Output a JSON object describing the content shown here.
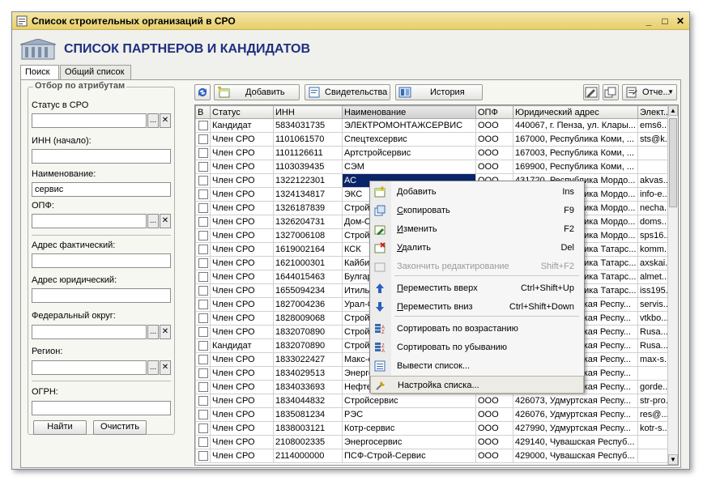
{
  "window": {
    "title": "Список строительных организаций в СРО",
    "minimize": "_",
    "restore": "□",
    "close": "✕"
  },
  "page_title": "СПИСОК ПАРТНЕРОВ И КАНДИДАТОВ",
  "tabs": [
    "Поиск",
    "Общий список"
  ],
  "filter": {
    "legend": "Отбор по атрибутам",
    "status_label": "Статус в СРО",
    "status_value": "",
    "inn_label": "ИНН (начало):",
    "inn_value": "",
    "name_label": "Наименование:",
    "name_value": "сервис",
    "opf_label": "ОПФ:",
    "opf_value": "",
    "addr_fact_label": "Адрес фактический:",
    "addr_fact_value": "",
    "addr_jur_label": "Адрес юридический:",
    "addr_jur_value": "",
    "fed_okrug_label": "Федеральный округ:",
    "fed_okrug_value": "",
    "region_label": "Регион:",
    "region_value": "",
    "ogrn_label": "ОГРН:",
    "ogrn_value": "",
    "select_btn": "...",
    "clear_btn": "✕",
    "find_btn": "Найти",
    "reset_btn": "Очистить"
  },
  "toolbar": {
    "add": "Добавить",
    "certs": "Свидетельства",
    "history": "История",
    "reports": "Отче..."
  },
  "table": {
    "columns": [
      "В",
      "Статус",
      "ИНН",
      "Наименование",
      "ОПФ",
      "Юридический адрес",
      "Элект..."
    ],
    "rows": [
      [
        "Кандидат",
        "5834031735",
        "ЭЛЕКТРОМОНТАЖСЕРВИС",
        "ООО",
        "440067, г. Пенза, ул. Клары...",
        "ems6..."
      ],
      [
        "Член СРО",
        "1101061570",
        "Спецтехсервис",
        "ООО",
        "167000, Республика Коми, ...",
        "sts@k..."
      ],
      [
        "Член СРО",
        "1101126611",
        "Артстройсервис",
        "ООО",
        "167003, Республика Коми, ...",
        ""
      ],
      [
        "Член СРО",
        "1103039435",
        "СЭМ",
        "ООО",
        "169900, Республика Коми, ...",
        ""
      ],
      [
        "Член СРО",
        "1322122301",
        "АС",
        "ООО",
        "431720, Республика Мордо...",
        "akvas..."
      ],
      [
        "Член СРО",
        "1324134817",
        "ЭКС",
        "ООО",
        "431720, Республика Мордо...",
        "info-e..."
      ],
      [
        "Член СРО",
        "1326187839",
        "Стройсе",
        "ООО",
        "430000, Республика Мордо...",
        "necha..."
      ],
      [
        "Член СРО",
        "1326204731",
        "Дом-Сер",
        "ООО",
        "430000, Республика Мордо...",
        "doms..."
      ],
      [
        "Член СРО",
        "1327006108",
        "СтройПр",
        "ООО",
        "430000, Республика Мордо...",
        "sps16..."
      ],
      [
        "Член СРО",
        "1619002164",
        "КСК",
        "ООО",
        "422000, Республика Татарс...",
        "komm..."
      ],
      [
        "Член СРО",
        "1621000301",
        "Кайбицы",
        "ООО",
        "422330, Республика Татарс...",
        "axskai..."
      ],
      [
        "Член СРО",
        "1644015463",
        "Булгар-С",
        "ООО",
        "423450, Республика Татарс...",
        "almet..."
      ],
      [
        "Член СРО",
        "1655094234",
        "ИтильСт",
        "ООО",
        "420000, Республика Татарс...",
        "iss195..."
      ],
      [
        "Член СРО",
        "1827004236",
        "Урал-Се",
        "ООО",
        "427430, Удмуртская Респу...",
        "servis..."
      ],
      [
        "Член СРО",
        "1828009068",
        "Стройсе",
        "ООО",
        "427620, Удмуртская Респу...",
        "vtkbo..."
      ],
      [
        "Член СРО",
        "1832070890",
        "Строй-С",
        "ООО",
        "426000, Удмуртская Респу...",
        "Rusa..."
      ],
      [
        "Кандидат",
        "1832070890",
        "Строй-С",
        "ООО",
        "426000, Удмуртская Респу...",
        "Rusa..."
      ],
      [
        "Член СРО",
        "1833022427",
        "Макс-се",
        "ООО",
        "426000, Удмуртская Респу...",
        "max-s..."
      ],
      [
        "Член СРО",
        "1834029513",
        "Энергос",
        "ООО",
        "426000, Удмуртская Респу...",
        ""
      ],
      [
        "Член СРО",
        "1834033693",
        "Нефтес",
        "ООО",
        "426000, Удмуртская Респу...",
        "gorde..."
      ],
      [
        "Член СРО",
        "1834044832",
        "Стройсервис",
        "ООО",
        "426073, Удмуртская Респу...",
        "str-pro..."
      ],
      [
        "Член СРО",
        "1835081234",
        "РЭС",
        "ООО",
        "426076, Удмуртская Респу...",
        "res@..."
      ],
      [
        "Член СРО",
        "1838003121",
        "Котр-сервис",
        "ООО",
        "427990, Удмуртская Респу...",
        "kotr-s..."
      ],
      [
        "Член СРО",
        "2108002335",
        "Энергосервис",
        "ООО",
        "429140, Чувашская Респуб...",
        ""
      ],
      [
        "Член СРО",
        "2114000000",
        "ПСФ-Строй-Сервис",
        "ООО",
        "429000, Чувашская Респуб...",
        ""
      ]
    ]
  },
  "context_menu": {
    "items": [
      {
        "label": "Добавить",
        "shortcut": "Ins",
        "ul": "Д"
      },
      {
        "label": "Скопировать",
        "shortcut": "F9",
        "ul": "С"
      },
      {
        "label": "Изменить",
        "shortcut": "F2",
        "ul": "И"
      },
      {
        "label": "Удалить",
        "shortcut": "Del",
        "ul": "У"
      },
      {
        "label": "Закончить редактирование",
        "shortcut": "Shift+F2",
        "ul": ""
      },
      {
        "label": "Переместить вверх",
        "shortcut": "Ctrl+Shift+Up",
        "ul": "П"
      },
      {
        "label": "Переместить вниз",
        "shortcut": "Ctrl+Shift+Down",
        "ul": "П"
      },
      {
        "label": "Сортировать по возрастанию",
        "shortcut": "",
        "ul": ""
      },
      {
        "label": "Сортировать по убыванию",
        "shortcut": "",
        "ul": ""
      },
      {
        "label": "Вывести список...",
        "shortcut": "",
        "ul": ""
      },
      {
        "label": "Настройка списка...",
        "shortcut": "",
        "ul": ""
      }
    ]
  },
  "colors": {
    "title_accent": "#1f2f80",
    "selection": "#0a246a",
    "titlebar": "#e8cf6a"
  }
}
